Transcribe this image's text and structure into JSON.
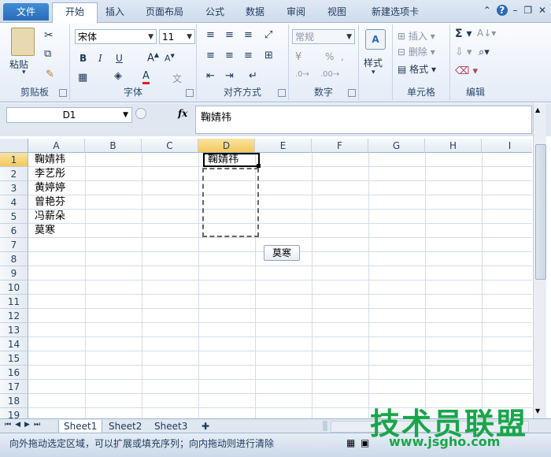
{
  "tabs": {
    "file": "文件",
    "home": "开始",
    "insert": "插入",
    "layout": "页面布局",
    "formulas": "公式",
    "data": "数据",
    "review": "审阅",
    "view": "视图",
    "newtab": "新建选项卡"
  },
  "clipboard": {
    "paste": "粘贴",
    "label": "剪贴板"
  },
  "font": {
    "name": "宋体",
    "size": "11",
    "label": "字体",
    "bold": "B",
    "italic": "I",
    "underline": "U"
  },
  "alignment": {
    "label": "对齐方式"
  },
  "number": {
    "format": "常规",
    "label": "数字",
    "percent": "%"
  },
  "styles": {
    "label": "样式"
  },
  "cells": {
    "insert": "插入",
    "delete": "删除",
    "format": "格式",
    "label": "单元格"
  },
  "editing": {
    "label": "编辑"
  },
  "formula_bar": {
    "name_box": "D1",
    "fx": "fx",
    "content": "鞠婧祎"
  },
  "columns": [
    "A",
    "B",
    "C",
    "D",
    "E",
    "F",
    "G",
    "H",
    "I"
  ],
  "rows": [
    "1",
    "2",
    "3",
    "4",
    "5",
    "6",
    "7",
    "8",
    "9",
    "10",
    "11",
    "12",
    "13",
    "14",
    "15",
    "16",
    "17",
    "18",
    "19"
  ],
  "cells_data": {
    "A1": "鞠婧祎",
    "A2": "李艺彤",
    "A3": "黄婷婷",
    "A4": "曾艳芬",
    "A5": "冯薪朵",
    "A6": "莫寒",
    "D1": "鞠婧祎"
  },
  "autofill_tip": "莫寒",
  "sheets": [
    "Sheet1",
    "Sheet2",
    "Sheet3"
  ],
  "status_text": "向外拖动选定区域，可以扩展或填充序列；向内拖动则进行清除",
  "watermark": {
    "main": "技术员联盟",
    "url": "www.jsgho.com"
  },
  "colors": {
    "accent": "#2a6bb8",
    "selection_header": "#f3c85b",
    "watermark": "#19a64a"
  }
}
